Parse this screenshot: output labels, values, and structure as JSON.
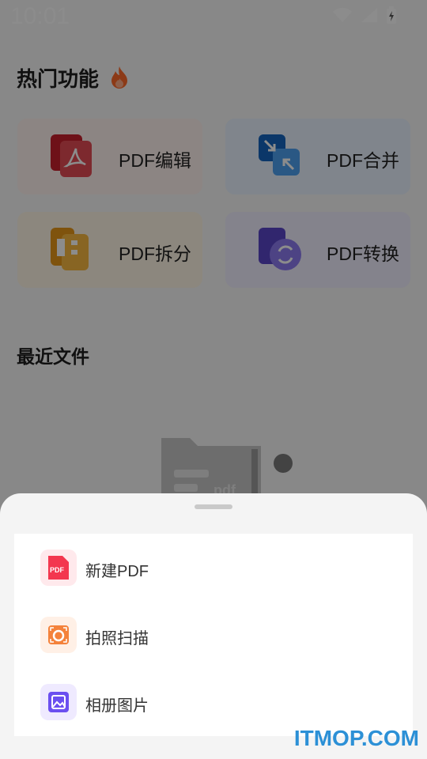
{
  "status_bar": {
    "time": "10:01"
  },
  "hot": {
    "title": "热门功能",
    "cards": [
      {
        "label": "PDF编辑",
        "icon": "pdf-edit-icon",
        "color": "#d83a45"
      },
      {
        "label": "PDF合并",
        "icon": "pdf-merge-icon",
        "color": "#1f86e0"
      },
      {
        "label": "PDF拆分",
        "icon": "pdf-split-icon",
        "color": "#f0a625"
      },
      {
        "label": "PDF转换",
        "icon": "pdf-convert-icon",
        "color": "#6a58e0"
      }
    ]
  },
  "recent": {
    "title": "最近文件",
    "placeholder_text": "pdf"
  },
  "sheet": {
    "items": [
      {
        "label": "新建PDF",
        "icon": "new-pdf-icon",
        "color": "#f3374f"
      },
      {
        "label": "拍照扫描",
        "icon": "camera-scan-icon",
        "color": "#f4823b"
      },
      {
        "label": "相册图片",
        "icon": "gallery-image-icon",
        "color": "#6b4ff0"
      }
    ]
  },
  "watermark": "ITMOP.COM"
}
